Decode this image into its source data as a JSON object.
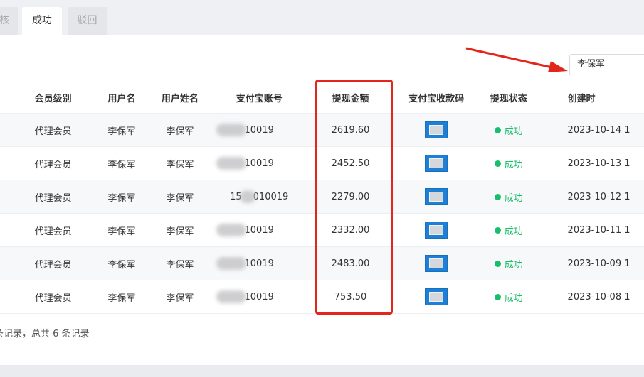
{
  "tabs": [
    {
      "label": "核"
    },
    {
      "label": "成功"
    },
    {
      "label": "驳回"
    }
  ],
  "search": {
    "value": "李保军"
  },
  "columns": [
    "会员级别",
    "用户名",
    "用户姓名",
    "支付宝账号",
    "提现金额",
    "支付宝收款码",
    "提现状态",
    "创建时"
  ],
  "rows": [
    {
      "level": "代理会员",
      "username": "李保军",
      "realname": "李保军",
      "account_prefix": "",
      "account_suffix": "10019",
      "amount": "2619.60",
      "status": "成功",
      "created": "2023-10-14 1"
    },
    {
      "level": "代理会员",
      "username": "李保军",
      "realname": "李保军",
      "account_prefix": "",
      "account_suffix": "10019",
      "amount": "2452.50",
      "status": "成功",
      "created": "2023-10-13 1"
    },
    {
      "level": "代理会员",
      "username": "李保军",
      "realname": "李保军",
      "account_prefix": "15",
      "account_suffix": "010019",
      "amount": "2279.00",
      "status": "成功",
      "created": "2023-10-12 1"
    },
    {
      "level": "代理会员",
      "username": "李保军",
      "realname": "李保军",
      "account_prefix": "",
      "account_suffix": "10019",
      "amount": "2332.00",
      "status": "成功",
      "created": "2023-10-11 1"
    },
    {
      "level": "代理会员",
      "username": "李保军",
      "realname": "李保军",
      "account_prefix": "",
      "account_suffix": "10019",
      "amount": "2483.00",
      "status": "成功",
      "created": "2023-10-09 1"
    },
    {
      "level": "代理会员",
      "username": "李保军",
      "realname": "李保军",
      "account_prefix": "",
      "account_suffix": "10019",
      "amount": "753.50",
      "status": "成功",
      "created": "2023-10-08 1"
    }
  ],
  "footer": {
    "text": "条记录，总共 6 条记录"
  },
  "colors": {
    "accent_green": "#19be6b",
    "level_green": "#18a58a",
    "highlight_red": "#e2261b",
    "qr_blue": "#1e7fd6"
  },
  "icons": {
    "qr": "qr-code-icon",
    "status": "status-dot-icon",
    "arrow": "red-arrow-annotation"
  }
}
